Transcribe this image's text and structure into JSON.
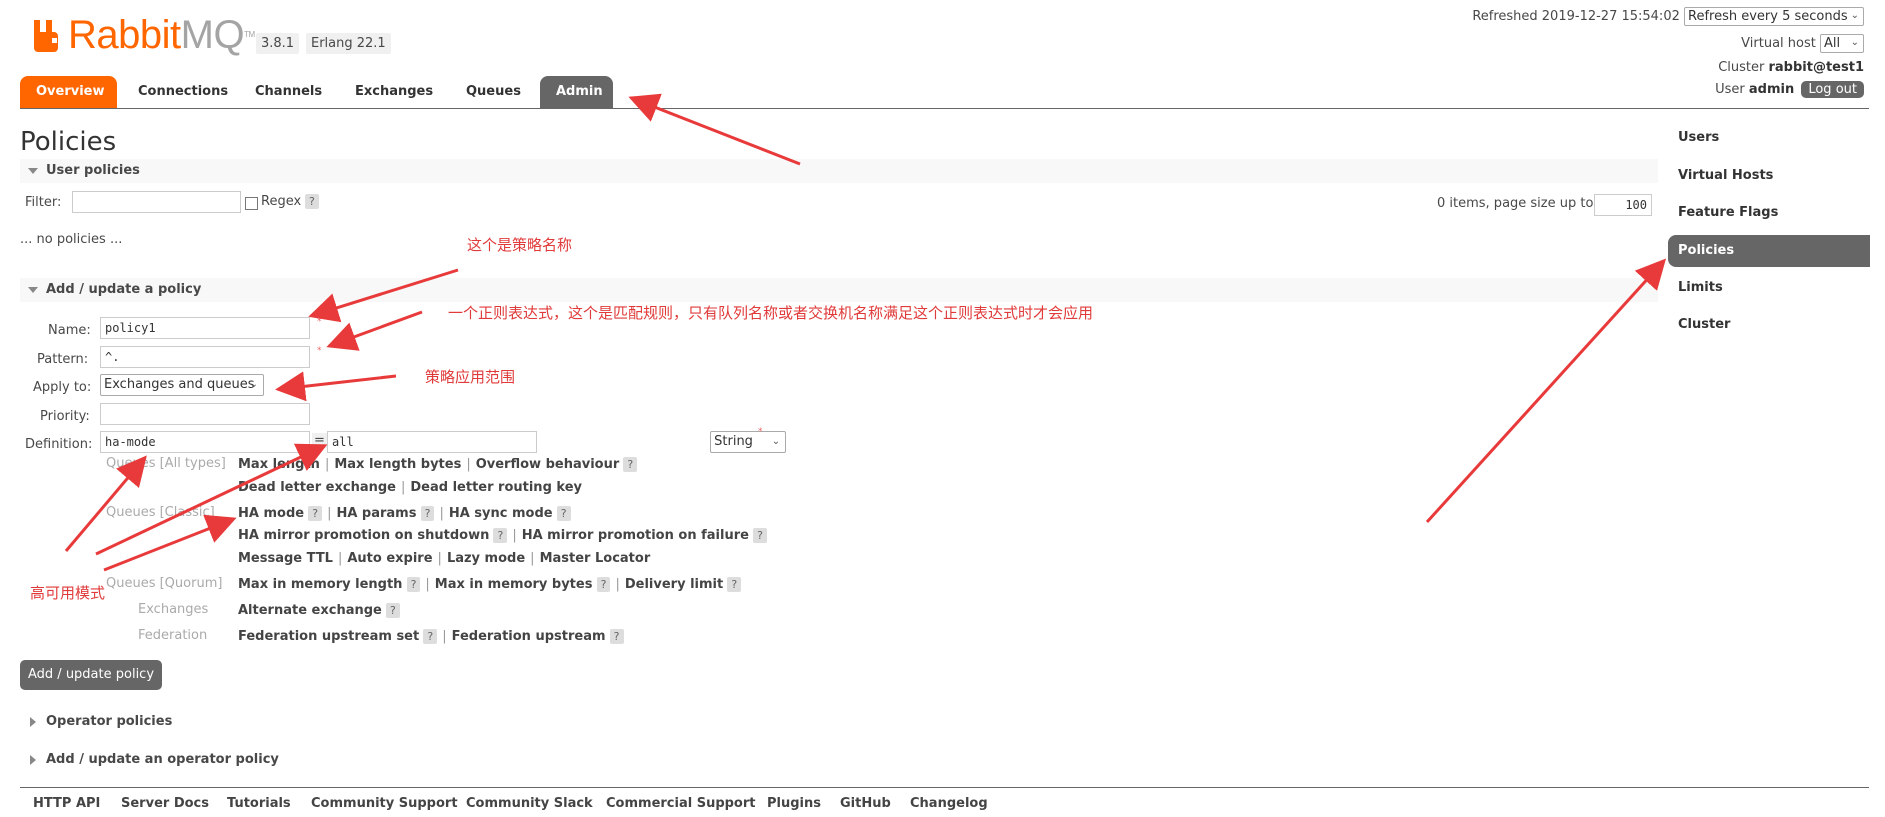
{
  "header": {
    "logo_text_rabbit": "Rabbit",
    "logo_text_mq": "MQ",
    "logo_tm": "TM",
    "version": "3.8.1",
    "erlang": "Erlang 22.1",
    "refreshed_label": "Refreshed 2019-12-27 15:54:02",
    "refresh_select": "Refresh every 5 seconds",
    "virtual_host_label": "Virtual host",
    "virtual_host_value": "All",
    "cluster_label": "Cluster",
    "cluster_value": "rabbit@test1",
    "user_label": "User",
    "user_value": "admin",
    "logout": "Log out"
  },
  "tabs": [
    "Overview",
    "Connections",
    "Channels",
    "Exchanges",
    "Queues",
    "Admin"
  ],
  "sidebar": [
    "Users",
    "Virtual Hosts",
    "Feature Flags",
    "Policies",
    "Limits",
    "Cluster"
  ],
  "main": {
    "title": "Policies",
    "user_policies": {
      "header": "User policies",
      "filter_label": "Filter:",
      "filter_value": "",
      "regex_label": "Regex",
      "help": "?",
      "items_text": "0 items, page size up to",
      "page_size": "100",
      "empty_text": "... no policies ..."
    },
    "add_policy": {
      "header": "Add / update a policy",
      "name_label": "Name:",
      "name_value": "policy1",
      "pattern_label": "Pattern:",
      "pattern_value": "^.",
      "apply_label": "Apply to:",
      "apply_value": "Exchanges and queues",
      "priority_label": "Priority:",
      "priority_value": "",
      "definition_label": "Definition:",
      "def_key": "ha-mode",
      "def_eq": "=",
      "def_value": "all",
      "def_type": "String",
      "groups": [
        {
          "label": "Queues [All types]",
          "rows": [
            [
              "Max length",
              "Max length bytes",
              "Overflow behaviour"
            ],
            [
              "Dead letter exchange",
              "Dead letter routing key"
            ]
          ]
        },
        {
          "label": "Queues [Classic]",
          "rows": [
            [
              "HA mode",
              "HA params",
              "HA sync mode"
            ],
            [
              "HA mirror promotion on shutdown",
              "HA mirror promotion on failure"
            ],
            [
              "Message TTL",
              "Auto expire",
              "Lazy mode",
              "Master Locator"
            ]
          ]
        },
        {
          "label": "Queues [Quorum]",
          "rows": [
            [
              "Max in memory length",
              "Max in memory bytes",
              "Delivery limit"
            ]
          ]
        },
        {
          "label": "Exchanges",
          "rows": [
            [
              "Alternate exchange"
            ]
          ]
        },
        {
          "label": "Federation",
          "rows": [
            [
              "Federation upstream set",
              "Federation upstream"
            ]
          ]
        }
      ],
      "submit": "Add / update policy"
    },
    "operator_policies": "Operator policies",
    "add_operator_policy": "Add / update an operator policy"
  },
  "footer": [
    "HTTP API",
    "Server Docs",
    "Tutorials",
    "Community Support",
    "Community Slack",
    "Commercial Support",
    "Plugins",
    "GitHub",
    "Changelog"
  ],
  "annotations": {
    "policy_name": "这个是策略名称",
    "pattern": "一个正则表达式，这个是匹配规则，只有队列名称或者交换机名称满足这个正则表达式时才会应用",
    "apply_scope": "策略应用范围",
    "ha_mode": "高可用模式"
  },
  "colors": {
    "accent": "#ff6600",
    "tab_grey": "#666666",
    "annotation": "#e03a3a"
  }
}
